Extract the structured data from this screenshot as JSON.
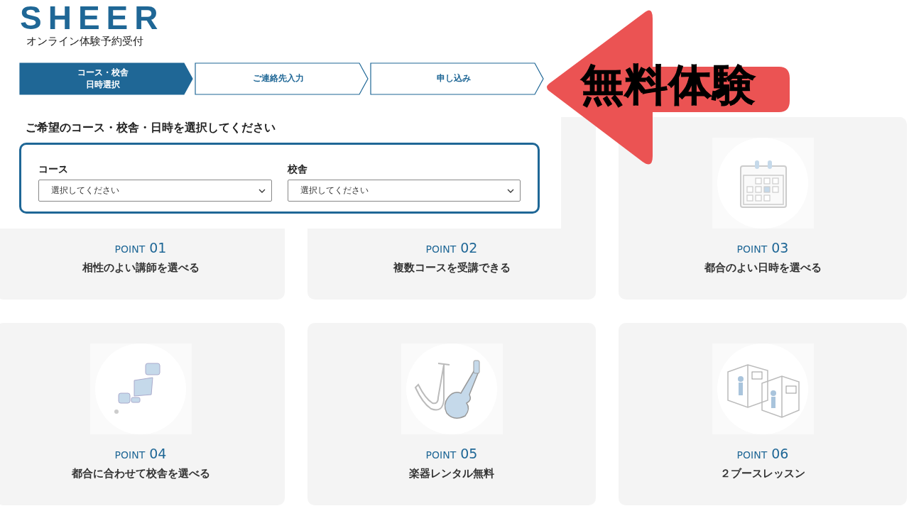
{
  "logo": "SHEER",
  "subtitle": "オンライン体験予約受付",
  "steps": [
    {
      "label": "コース・校舎日時選択",
      "selected": true
    },
    {
      "label": "ご連絡先入力",
      "selected": false
    },
    {
      "label": "申し込み",
      "selected": false
    }
  ],
  "heading": "ご希望のコース・校舎・日時を選択してください",
  "fields": [
    {
      "label": "コース",
      "value": "選択してください"
    },
    {
      "label": "校舎",
      "value": "選択してください"
    }
  ],
  "points": [
    {
      "label": "POINT",
      "number": "01",
      "title": "相性のよい講師を選べる"
    },
    {
      "label": "POINT",
      "number": "02",
      "title": "複数コースを受講できる"
    },
    {
      "label": "POINT",
      "number": "03",
      "title": "都合のよい日時を選べる",
      "kind": "calendar"
    },
    {
      "label": "POINT",
      "number": "04",
      "title": "都合に合わせて校舎を選べる",
      "kind": "map"
    },
    {
      "label": "POINT",
      "number": "05",
      "title": "楽器レンタル無料",
      "kind": "instruments"
    },
    {
      "label": "POINT",
      "number": "06",
      "title": "２ブースレッスン",
      "kind": "booths"
    }
  ],
  "callout": "無料体験"
}
